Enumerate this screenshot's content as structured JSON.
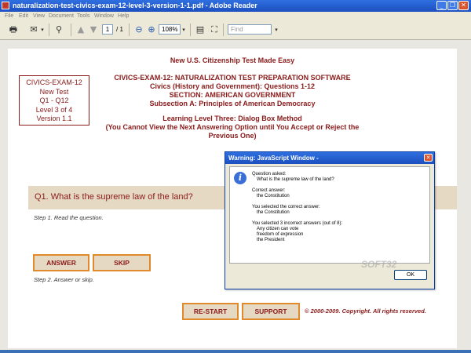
{
  "window": {
    "title": "naturalization-test-civics-exam-12-level-3-version-1-1.pdf - Adobe Reader",
    "minimize_glyph": "_",
    "maximize_glyph": "❐",
    "close_glyph": "✕"
  },
  "menu": [
    "File",
    "Edit",
    "View",
    "Document",
    "Tools",
    "Window",
    "Help"
  ],
  "toolbar": {
    "page_current": "1",
    "page_total": "/ 1",
    "zoom": "108%",
    "find_placeholder": "Find"
  },
  "document": {
    "heading": "New U.S. Citizenship Test Made Easy",
    "topic_box": [
      "CIVICS-EXAM-12",
      "New Test",
      "Q1 - Q12",
      "Level 3 of 4",
      "Version 1.1"
    ],
    "title_lines": [
      "CIVICS-EXAM-12: NATURALIZATION TEST PREPARATION SOFTWARE",
      "Civics (History and Government): Questions 1-12",
      "SECTION: AMERICAN GOVERNMENT",
      "Subsection A: Principles of American Democracy"
    ],
    "method_lines": [
      "Learning Level Three: Dialog Box Method",
      "(You Cannot View the Next Answering Option until You Accept or Reject the",
      "Previous One)"
    ],
    "question": "Q1. What is the supreme law of the land?",
    "step1": "Step 1. Read the question.",
    "answer_button": "ANSWER",
    "skip_button": "SKIP",
    "step2": "Step 2. Answer or skip.",
    "restart_button": "RE-START",
    "support_button": "SUPPORT",
    "copyright": "© 2000-2009. Copyright. All rights reserved."
  },
  "dialog": {
    "title": "Warning: JavaScript Window -",
    "lines": [
      "Question asked:",
      "What is the supreme law of the land?",
      "Correct answer:",
      "the Constitution",
      "You selected the correct answer:",
      "the Constitution",
      "You selected 3 incorrect answers (out of 8):",
      "Any citizen can vote",
      "freedom of expression",
      "the President"
    ],
    "ok_label": "OK"
  },
  "watermark": "SOFT32"
}
